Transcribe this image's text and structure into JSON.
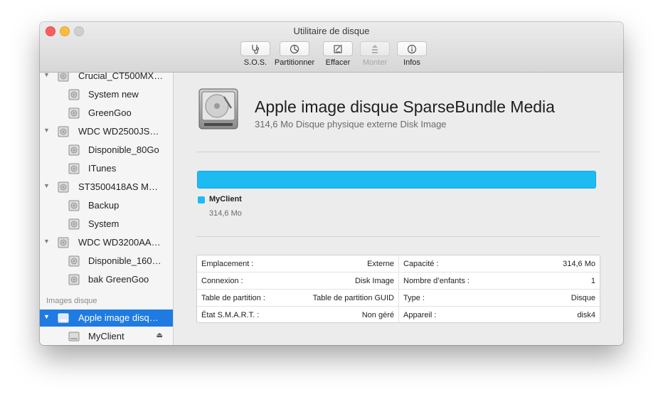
{
  "window": {
    "title": "Utilitaire de disque"
  },
  "toolbar": {
    "sos": "S.O.S.",
    "partition": "Partitionner",
    "erase": "Effacer",
    "mount": "Monter",
    "info": "Infos"
  },
  "sidebar": {
    "items": [
      {
        "label": "Crucial_CT500MX…",
        "level": 0,
        "icon": "hard-disk-icon"
      },
      {
        "label": "System new",
        "level": 1,
        "icon": "volume-icon"
      },
      {
        "label": "GreenGoo",
        "level": 1,
        "icon": "volume-icon"
      },
      {
        "label": "WDC WD2500JS…",
        "level": 0,
        "icon": "hard-disk-icon"
      },
      {
        "label": "Disponible_80Go",
        "level": 1,
        "icon": "volume-icon"
      },
      {
        "label": "ITunes",
        "level": 1,
        "icon": "volume-icon"
      },
      {
        "label": "ST3500418AS M…",
        "level": 0,
        "icon": "hard-disk-icon"
      },
      {
        "label": "Backup",
        "level": 1,
        "icon": "volume-icon"
      },
      {
        "label": "System",
        "level": 1,
        "icon": "volume-icon"
      },
      {
        "label": "WDC WD3200AA…",
        "level": 0,
        "icon": "hard-disk-icon"
      },
      {
        "label": "Disponible_160…",
        "level": 1,
        "icon": "volume-icon"
      },
      {
        "label": "bak GreenGoo",
        "level": 1,
        "icon": "volume-icon"
      }
    ],
    "section_images": "Images disque",
    "image_items": [
      {
        "label": "Apple image disq…",
        "selected": true,
        "icon": "disk-image-icon"
      },
      {
        "label": "MyClient",
        "icon": "volume-icon",
        "eject": "⏏"
      }
    ]
  },
  "main": {
    "title": "Apple image disque SparseBundle Media",
    "subtitle": "314,6 Mo Disque physique externe Disk Image",
    "usage": {
      "name": "MyClient",
      "size": "314,6 Mo",
      "fraction": 1.0,
      "color": "#1ebbf3"
    },
    "info": {
      "left": [
        {
          "key": "Emplacement :",
          "value": "Externe"
        },
        {
          "key": "Connexion :",
          "value": "Disk Image"
        },
        {
          "key": "Table de partition :",
          "value": "Table de partition GUID"
        },
        {
          "key": "État S.M.A.R.T. :",
          "value": "Non géré"
        }
      ],
      "right": [
        {
          "key": "Capacité :",
          "value": "314,6 Mo"
        },
        {
          "key": "Nombre d’enfants :",
          "value": "1"
        },
        {
          "key": "Type :",
          "value": "Disque"
        },
        {
          "key": "Appareil :",
          "value": "disk4"
        }
      ]
    }
  },
  "colors": {
    "accent": "#1f7ae2",
    "usage": "#1ebbf3"
  }
}
